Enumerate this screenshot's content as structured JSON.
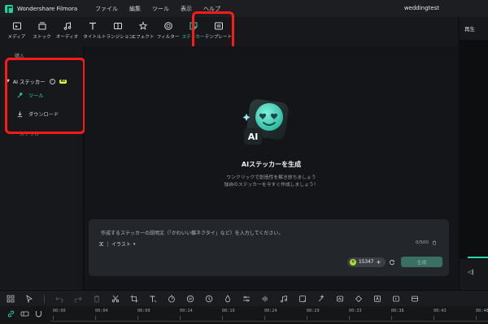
{
  "app": {
    "name": "Wondershare Filmora",
    "project": "weddingtest"
  },
  "menu": [
    "ファイル",
    "編集",
    "ツール",
    "表示",
    "ヘルプ"
  ],
  "toolbar": {
    "tabs": [
      {
        "label": "メディア",
        "icon": "media-icon"
      },
      {
        "label": "ストック",
        "icon": "stock-icon"
      },
      {
        "label": "オーディオ",
        "icon": "audio-icon"
      },
      {
        "label": "タイトル",
        "icon": "title-icon"
      },
      {
        "label": "トランジション",
        "icon": "transition-icon"
      },
      {
        "label": "エフェクト",
        "icon": "effect-icon"
      },
      {
        "label": "フィルター",
        "icon": "filter-icon"
      },
      {
        "label": "ステッカー",
        "icon": "sticker-icon",
        "active": true
      },
      {
        "label": "テンプレート",
        "icon": "template-icon"
      }
    ]
  },
  "left_panel": {
    "top_label": "購入",
    "ai_section": {
      "label": "AI ステッカー",
      "badge": "AI",
      "help": "?"
    },
    "items": [
      {
        "label": "ツール",
        "icon": "wand-icon",
        "active": true
      },
      {
        "label": "ダウンロード",
        "icon": "download-icon",
        "active": false
      }
    ],
    "below_label": "ステッカー"
  },
  "main": {
    "title": "AIステッカーを生成",
    "subtitle_lines": [
      "ワンクリックで創造性を解き放ちましょう",
      "独自のステッカーを今すぐ作成しましょう！"
    ],
    "prompt_placeholder": "作成するステッカーの説明文（「かわいい蝶ネクタイ」など）を入力してください。",
    "style_label": "イラスト",
    "char_count": "0/500",
    "credits": "15347",
    "generate_label": "生成"
  },
  "right_panel": {
    "title": "再生"
  },
  "timeline": {
    "ticks": [
      "00:00",
      "00:04",
      "00:09",
      "00:14",
      "00:19",
      "00:24",
      "00:29",
      "00:33",
      "00:38",
      "00:43",
      "00:48"
    ]
  },
  "colors": {
    "accent": "#2fd8b3",
    "highlight": "#ff1a1a",
    "ai_badge": "#d7ff3a"
  }
}
